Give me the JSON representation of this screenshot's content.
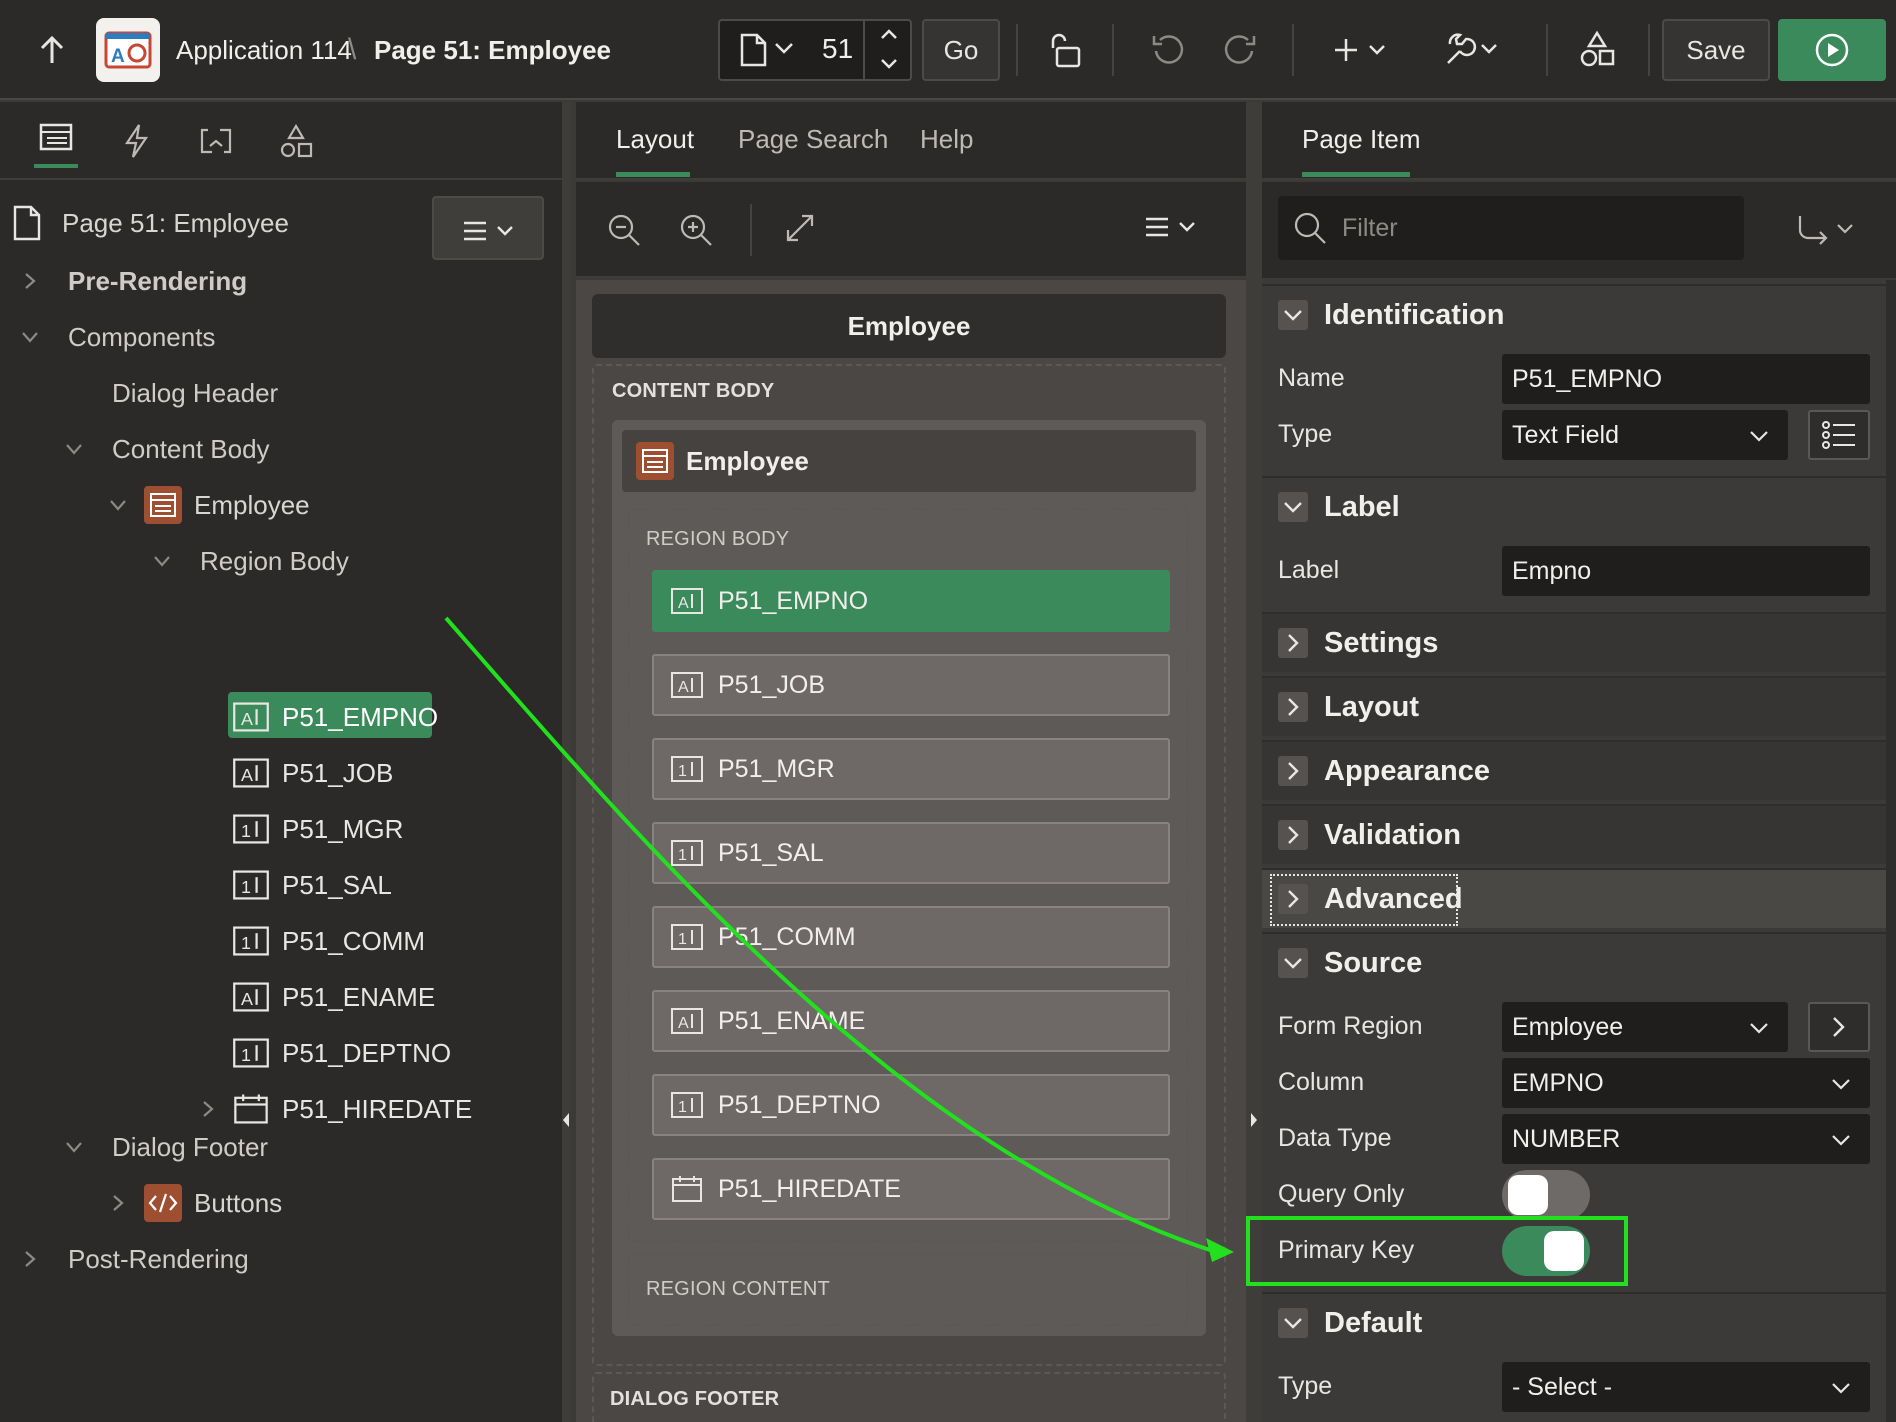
{
  "topbar": {
    "app_name": "Application 114",
    "separator": "\\",
    "page_title": "Page 51: Employee",
    "page_number": "51",
    "go_label": "Go",
    "save_label": "Save"
  },
  "left": {
    "page_node": "Page 51: Employee",
    "pre_rendering": "Pre-Rendering",
    "components": "Components",
    "dialog_header": "Dialog Header",
    "content_body": "Content Body",
    "employee": "Employee",
    "region_body": "Region Body",
    "items": [
      {
        "label": "P51_EMPNO",
        "icon": "text-field-icon"
      },
      {
        "label": "P51_JOB",
        "icon": "text-field-icon"
      },
      {
        "label": "P51_MGR",
        "icon": "number-field-icon"
      },
      {
        "label": "P51_SAL",
        "icon": "number-field-icon"
      },
      {
        "label": "P51_COMM",
        "icon": "number-field-icon"
      },
      {
        "label": "P51_ENAME",
        "icon": "text-field-icon"
      },
      {
        "label": "P51_DEPTNO",
        "icon": "number-field-icon"
      },
      {
        "label": "P51_HIREDATE",
        "icon": "date-picker-icon"
      }
    ],
    "dialog_footer": "Dialog Footer",
    "buttons": "Buttons",
    "post_rendering": "Post-Rendering"
  },
  "center": {
    "tabs": [
      "Layout",
      "Page Search",
      "Help"
    ],
    "canvas_title": "Employee",
    "content_body": "CONTENT BODY",
    "region_title": "Employee",
    "region_body": "REGION BODY",
    "items": [
      "P51_EMPNO",
      "P51_JOB",
      "P51_MGR",
      "P51_SAL",
      "P51_COMM",
      "P51_ENAME",
      "P51_DEPTNO",
      "P51_HIREDATE"
    ],
    "region_content": "REGION CONTENT",
    "dialog_footer": "DIALOG FOOTER"
  },
  "right": {
    "tab": "Page Item",
    "filter_placeholder": "Filter",
    "identification": {
      "title": "Identification",
      "name_label": "Name",
      "name_value": "P51_EMPNO",
      "type_label": "Type",
      "type_value": "Text Field"
    },
    "label": {
      "title": "Label",
      "label_label": "Label",
      "label_value": "Empno"
    },
    "collapsed_groups": [
      "Settings",
      "Layout",
      "Appearance",
      "Validation",
      "Advanced"
    ],
    "source": {
      "title": "Source",
      "form_region_label": "Form Region",
      "form_region_value": "Employee",
      "column_label": "Column",
      "column_value": "EMPNO",
      "data_type_label": "Data Type",
      "data_type_value": "NUMBER",
      "query_only_label": "Query Only",
      "query_only_on": false,
      "primary_key_label": "Primary Key",
      "primary_key_on": true
    },
    "default": {
      "title": "Default",
      "type_label": "Type",
      "type_value": "- Select -"
    }
  },
  "colors": {
    "accent_green": "#3a8a5b",
    "annotation_green": "#22e01d",
    "app_icon_red": "#c74634"
  }
}
